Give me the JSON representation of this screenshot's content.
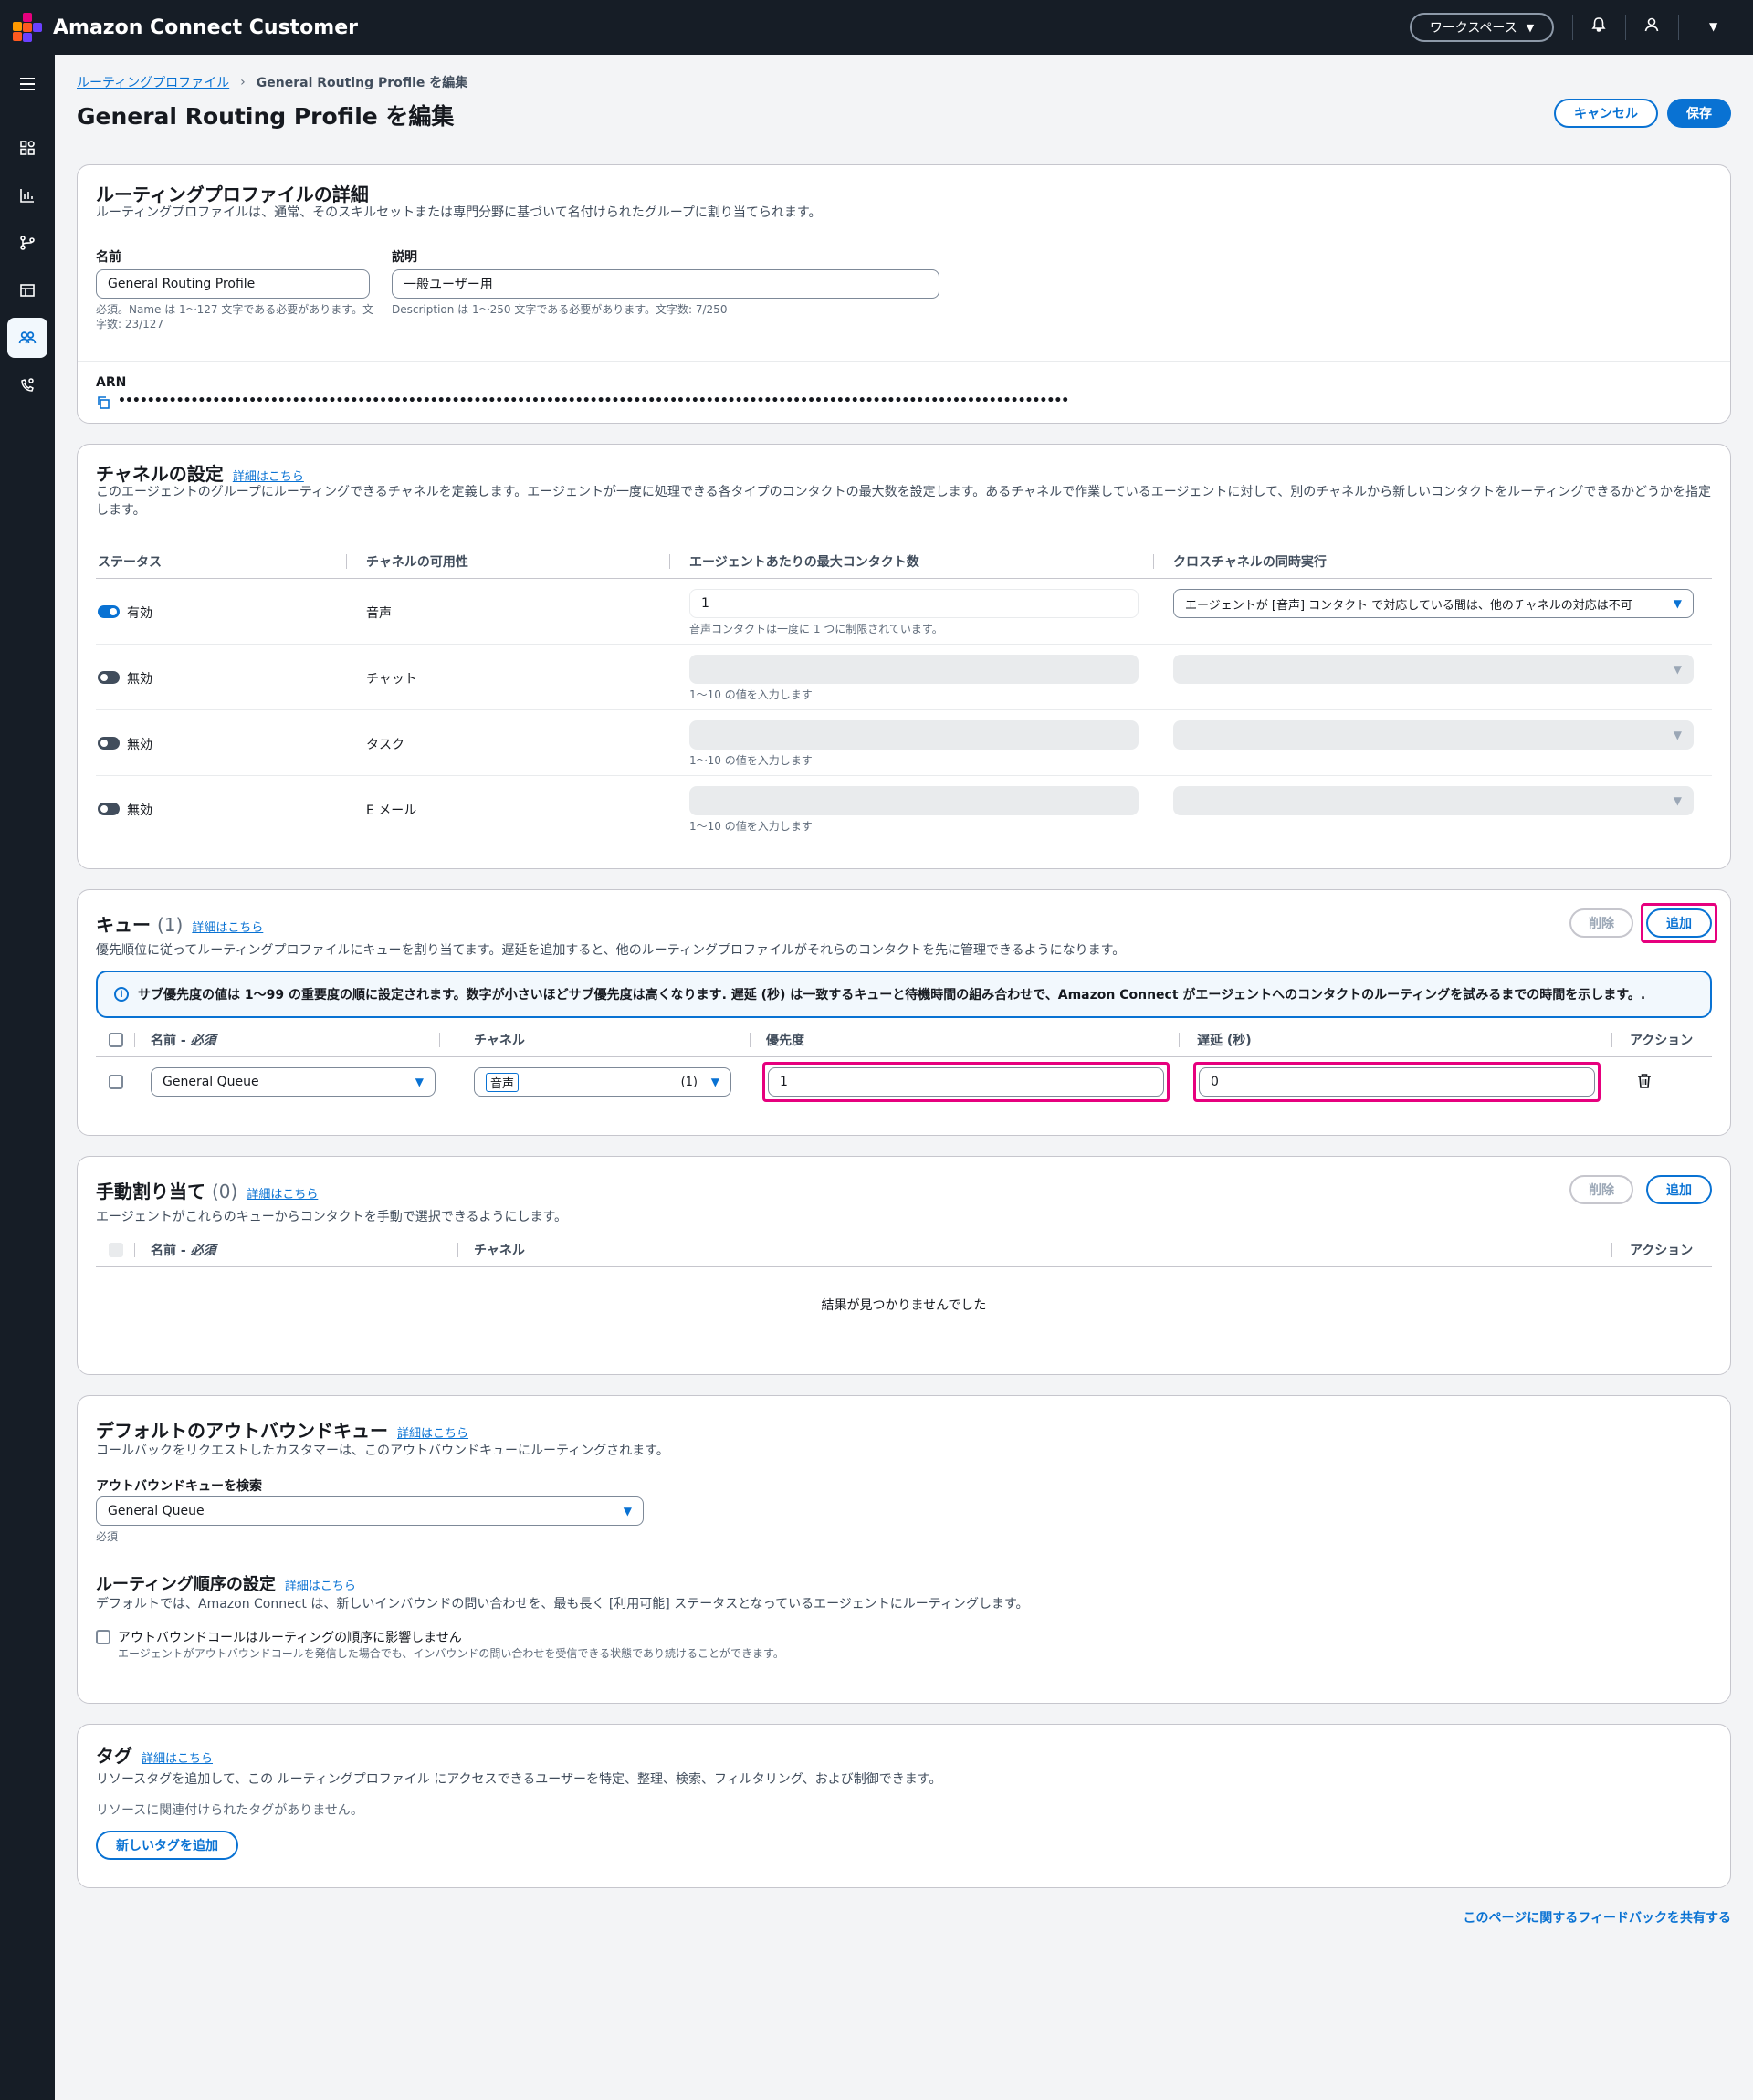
{
  "app": {
    "title": "Amazon Connect Customer",
    "workspace_label": "ワークスペース"
  },
  "breadcrumb": {
    "parent": "ルーティングプロファイル",
    "current": "General Routing Profile を編集"
  },
  "page": {
    "title": "General Routing Profile を編集",
    "cancel_label": "キャンセル",
    "save_label": "保存"
  },
  "details": {
    "title": "ルーティングプロファイルの詳細",
    "description": "ルーティングプロファイルは、通常、そのスキルセットまたは専門分野に基づいて名付けられたグループに割り当てられます。",
    "name_label": "名前",
    "name_value": "General Routing Profile",
    "name_hint": "必須。Name は 1～127 文字である必要があります。文字数: 23/127",
    "desc_label": "説明",
    "desc_value": "一般ユーザー用",
    "desc_hint": "Description は 1～250 文字である必要があります。文字数: 7/250",
    "arn_label": "ARN",
    "arn_value": "•••••••••••••••••••••••••••••••••••••••••••••••••••••••••••••••••••••••••••••••••••••••••••••••••••••••••••••••••••••••••••••••••••"
  },
  "channels": {
    "title": "チャネルの設定",
    "info": "詳細はこちら",
    "description": "このエージェントのグループにルーティングできるチャネルを定義します。エージェントが一度に処理できる各タイプのコンタクトの最大数を設定します。あるチャネルで作業しているエージェントに対して、別のチャネルから新しいコンタクトをルーティングできるかどうかを指定します。",
    "headers": [
      "ステータス",
      "チャネルの可用性",
      "エージェントあたりの最大コンタクト数",
      "クロスチャネルの同時実行"
    ],
    "rows": [
      {
        "status": "有効",
        "enabled": true,
        "channel": "音声",
        "max": "1",
        "hint": "音声コンタクトは一度に 1 つに制限されています。",
        "cross": "エージェントが [音声] コンタクト で対応している間は、他のチャネルの対応は不可"
      },
      {
        "status": "無効",
        "enabled": false,
        "channel": "チャット",
        "max": "",
        "hint": "1～10 の値を入力します",
        "cross": ""
      },
      {
        "status": "無効",
        "enabled": false,
        "channel": "タスク",
        "max": "",
        "hint": "1～10 の値を入力します",
        "cross": ""
      },
      {
        "status": "無効",
        "enabled": false,
        "channel": "E メール",
        "max": "",
        "hint": "1～10 の値を入力します",
        "cross": ""
      }
    ]
  },
  "queues": {
    "title": "キュー",
    "count": "(1)",
    "info": "詳細はこちら",
    "description": "優先順位に従ってルーティングプロファイルにキューを割り当てます。遅延を追加すると、他のルーティングプロファイルがそれらのコンタクトを先に管理できるようになります。",
    "delete_label": "削除",
    "add_label": "追加",
    "alert": "サブ優先度の値は 1～99 の重要度の順に設定されます。数字が小さいほどサブ優先度は高くなります. 遅延 (秒) は一致するキューと待機時間の組み合わせで、Amazon Connect がエージェントへのコンタクトのルーティングを試みるまでの時間を示します。.",
    "headers": {
      "name": "名前 - ",
      "required": "必須",
      "channel": "チャネル",
      "priority": "優先度",
      "delay": "遅延 (秒)",
      "action": "アクション"
    },
    "row": {
      "name": "General Queue",
      "channel": "音声",
      "channel_count": "(1)",
      "priority": "1",
      "delay": "0"
    }
  },
  "manual": {
    "title": "手動割り当て",
    "count": "(0)",
    "info": "詳細はこちら",
    "description": "エージェントがこれらのキューからコンタクトを手動で選択できるようにします。",
    "delete_label": "削除",
    "add_label": "追加",
    "headers": {
      "name": "名前 - ",
      "required": "必須",
      "channel": "チャネル",
      "action": "アクション"
    },
    "empty": "結果が見つかりませんでした"
  },
  "outbound": {
    "title": "デフォルトのアウトバウンドキュー",
    "info": "詳細はこちら",
    "description": "コールバックをリクエストしたカスタマーは、このアウトバウンドキューにルーティングされます。",
    "search_label": "アウトバウンドキューを検索",
    "value": "General Queue",
    "hint": "必須",
    "order_title": "ルーティング順序の設定",
    "order_info": "詳細はこちら",
    "order_description": "デフォルトでは、Amazon Connect は、新しいインバウンドの問い合わせを、最も長く [利用可能] ステータスとなっているエージェントにルーティングします。",
    "checkbox_label": "アウトバウンドコールはルーティングの順序に影響しません",
    "checkbox_hint": "エージェントがアウトバウンドコールを発信した場合でも、インバウンドの問い合わせを受信できる状態であり続けることができます。"
  },
  "tags": {
    "title": "タグ",
    "info": "詳細はこちら",
    "description": "リソースタグを追加して、この ルーティングプロファイル にアクセスできるユーザーを特定、整理、検索、フィルタリング、および制御できます。",
    "empty": "リソースに関連付けられたタグがありません。",
    "add_label": "新しいタグを追加"
  },
  "feedback": "このページに関するフィードバックを共有する"
}
